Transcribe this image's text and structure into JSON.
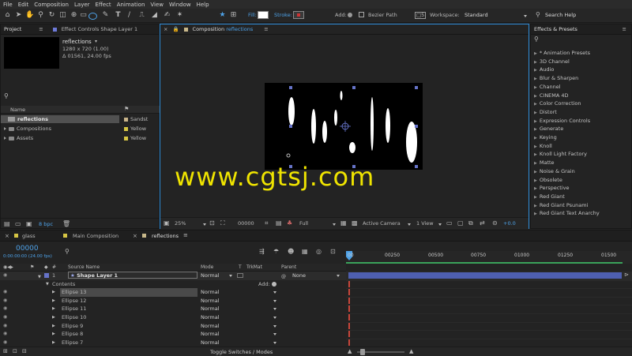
{
  "menu": [
    "File",
    "Edit",
    "Composition",
    "Layer",
    "Effect",
    "Animation",
    "View",
    "Window",
    "Help"
  ],
  "toolbar": {
    "fill_label": "Fill:",
    "stroke_label": "Stroke:",
    "add_label": "Add:",
    "bezier_label": "Bezier Path",
    "workspace_label": "Workspace:",
    "workspace_value": "Standard",
    "search_placeholder": "Search Help"
  },
  "project": {
    "tab": "Project",
    "effect_controls_tab": "Effect Controls Shape Layer 1",
    "item_name": "reflections",
    "item_dims": "1280 x 720 (1.00)",
    "item_duration": "Δ 01561, 24.00 fps",
    "col_name": "Name",
    "items": [
      {
        "name": "reflections",
        "label": "Sandst",
        "color": "#c9b48a",
        "selected": true,
        "type": "comp"
      },
      {
        "name": "Compositions",
        "label": "Yellow",
        "color": "#d6c544",
        "selected": false,
        "type": "folder"
      },
      {
        "name": "Assets",
        "label": "Yellow",
        "color": "#d6c544",
        "selected": false,
        "type": "folder"
      }
    ],
    "bpc": "8 bpc"
  },
  "comp_viewer": {
    "tab_prefix": "Composition",
    "tab_name": "reflections",
    "zoom": "25%",
    "timecode": "00000",
    "resolution": "Full",
    "camera": "Active Camera",
    "views": "1 View",
    "exposure": "+0.0",
    "watermark": "www.cgtsj.com"
  },
  "effects": {
    "title": "Effects & Presets",
    "categories": [
      "* Animation Presets",
      "3D Channel",
      "Audio",
      "Blur & Sharpen",
      "Channel",
      "CINEMA 4D",
      "Color Correction",
      "Distort",
      "Expression Controls",
      "Generate",
      "Keying",
      "Knoll",
      "Knoll Light Factory",
      "Matte",
      "Noise & Grain",
      "Obsolete",
      "Perspective",
      "Red Giant",
      "Red Giant Psunami",
      "Red Giant Text Anarchy"
    ]
  },
  "timeline": {
    "tabs": [
      "glass",
      "Main Composition",
      "reflections"
    ],
    "timecode": "00000",
    "timecode_sub": "0:00:00:00 (24.00 fps)",
    "col_num": "#",
    "col_source": "Source Name",
    "col_mode": "Mode",
    "col_t": "T",
    "col_trkmat": "TrkMat",
    "col_parent": "Parent",
    "layer": {
      "num": "1",
      "name": "Shape Layer 1",
      "mode": "Normal",
      "parent": "None"
    },
    "contents_label": "Contents",
    "add_label": "Add:",
    "ellipses": [
      {
        "name": "Ellipse 13",
        "mode": "Normal"
      },
      {
        "name": "Ellipse 12",
        "mode": "Normal"
      },
      {
        "name": "Ellipse 11",
        "mode": "Normal"
      },
      {
        "name": "Ellipse 10",
        "mode": "Normal"
      },
      {
        "name": "Ellipse 9",
        "mode": "Normal"
      },
      {
        "name": "Ellipse 8",
        "mode": "Normal"
      },
      {
        "name": "Ellipse 7",
        "mode": "Normal"
      }
    ],
    "ruler": [
      "00",
      "00250",
      "00500",
      "00750",
      "01000",
      "01250",
      "01500"
    ],
    "toggle_label": "Toggle Switches / Modes"
  },
  "colors": {
    "accent": "#2e8bd6",
    "layer_bar": "#4e5fb0",
    "timeline_green": "#3aa35a",
    "watermark": "#f0e600"
  }
}
